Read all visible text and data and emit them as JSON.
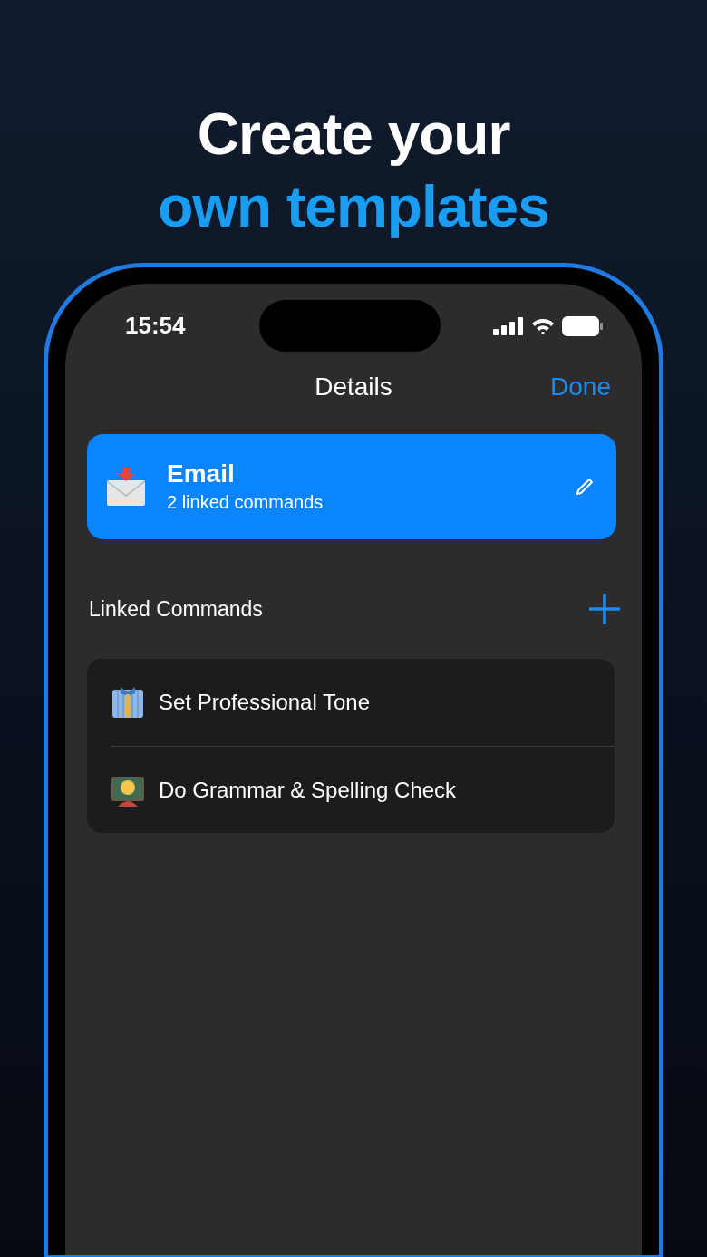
{
  "headline": {
    "line_1": "Create your",
    "line_2": "own templates"
  },
  "status_bar": {
    "time": "15:54"
  },
  "nav": {
    "title": "Details",
    "done": "Done"
  },
  "template": {
    "title": "Email",
    "subtitle": "2 linked commands"
  },
  "section": {
    "title": "Linked Commands"
  },
  "commands": [
    {
      "label": "Set Professional Tone"
    },
    {
      "label": "Do Grammar & Spelling Check"
    }
  ]
}
